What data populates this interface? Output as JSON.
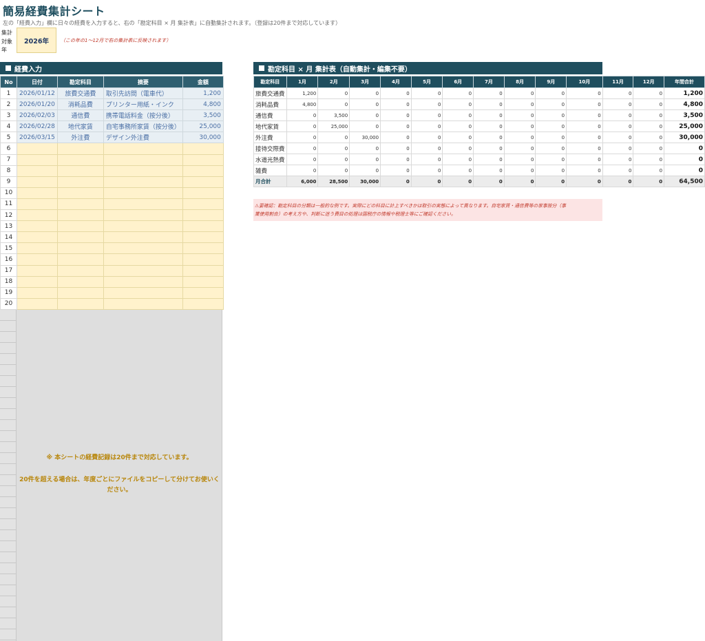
{
  "header": {
    "title": "簡易経費集計シート",
    "subtitle": "左の「経費入力」欄に日々の経費を入力すると、右の「勘定科目 × 月 集計表」に自動集計されます。（登録は20件まで対応しています）"
  },
  "year": {
    "label": "集計対象年",
    "value": "2026年",
    "note": "（この年の1〜12月で右の集計表に反映されます）"
  },
  "left": {
    "section_title": "経費入力",
    "columns": [
      "No",
      "日付",
      "勘定科目",
      "摘要",
      "金額"
    ],
    "rows": [
      {
        "no": "1",
        "date": "2026/01/12",
        "category": "旅費交通費",
        "description": "取引先訪問（電車代）",
        "amount": "1,200"
      },
      {
        "no": "2",
        "date": "2026/01/20",
        "category": "消耗品費",
        "description": "プリンター用紙・インク",
        "amount": "4,800"
      },
      {
        "no": "3",
        "date": "2026/02/03",
        "category": "通信費",
        "description": "携帯電話料金（按分後）",
        "amount": "3,500"
      },
      {
        "no": "4",
        "date": "2026/02/28",
        "category": "地代家賃",
        "description": "自宅事務所家賃（按分後）",
        "amount": "25,000"
      },
      {
        "no": "5",
        "date": "2026/03/15",
        "category": "外注費",
        "description": "デザイン外注費",
        "amount": "30,000"
      },
      {
        "no": "6",
        "date": "",
        "category": "",
        "description": "",
        "amount": ""
      },
      {
        "no": "7",
        "date": "",
        "category": "",
        "description": "",
        "amount": ""
      },
      {
        "no": "8",
        "date": "",
        "category": "",
        "description": "",
        "amount": ""
      },
      {
        "no": "9",
        "date": "",
        "category": "",
        "description": "",
        "amount": ""
      },
      {
        "no": "10",
        "date": "",
        "category": "",
        "description": "",
        "amount": ""
      },
      {
        "no": "11",
        "date": "",
        "category": "",
        "description": "",
        "amount": ""
      },
      {
        "no": "12",
        "date": "",
        "category": "",
        "description": "",
        "amount": ""
      },
      {
        "no": "13",
        "date": "",
        "category": "",
        "description": "",
        "amount": ""
      },
      {
        "no": "14",
        "date": "",
        "category": "",
        "description": "",
        "amount": ""
      },
      {
        "no": "15",
        "date": "",
        "category": "",
        "description": "",
        "amount": ""
      },
      {
        "no": "16",
        "date": "",
        "category": "",
        "description": "",
        "amount": ""
      },
      {
        "no": "17",
        "date": "",
        "category": "",
        "description": "",
        "amount": ""
      },
      {
        "no": "18",
        "date": "",
        "category": "",
        "description": "",
        "amount": ""
      },
      {
        "no": "19",
        "date": "",
        "category": "",
        "description": "",
        "amount": ""
      },
      {
        "no": "20",
        "date": "",
        "category": "",
        "description": "",
        "amount": ""
      }
    ],
    "limit_note_1": "※ 本シートの経費記録は20件まで対応しています。",
    "limit_note_2": "20件を超える場合は、年度ごとにファイルをコピーして分けてお使いください。"
  },
  "right": {
    "section_title": "勘定科目 × 月 集計表（自動集計・編集不要）",
    "columns": [
      "勘定科目",
      "1月",
      "2月",
      "3月",
      "4月",
      "5月",
      "6月",
      "7月",
      "8月",
      "9月",
      "10月",
      "11月",
      "12月",
      "年間合計"
    ],
    "rows": [
      {
        "category": "旅費交通費",
        "months": [
          "1,200",
          "0",
          "0",
          "0",
          "0",
          "0",
          "0",
          "0",
          "0",
          "0",
          "0",
          "0"
        ],
        "total": "1,200"
      },
      {
        "category": "消耗品費",
        "months": [
          "4,800",
          "0",
          "0",
          "0",
          "0",
          "0",
          "0",
          "0",
          "0",
          "0",
          "0",
          "0"
        ],
        "total": "4,800"
      },
      {
        "category": "通信費",
        "months": [
          "0",
          "3,500",
          "0",
          "0",
          "0",
          "0",
          "0",
          "0",
          "0",
          "0",
          "0",
          "0"
        ],
        "total": "3,500"
      },
      {
        "category": "地代家賃",
        "months": [
          "0",
          "25,000",
          "0",
          "0",
          "0",
          "0",
          "0",
          "0",
          "0",
          "0",
          "0",
          "0"
        ],
        "total": "25,000"
      },
      {
        "category": "外注費",
        "months": [
          "0",
          "0",
          "30,000",
          "0",
          "0",
          "0",
          "0",
          "0",
          "0",
          "0",
          "0",
          "0"
        ],
        "total": "30,000"
      },
      {
        "category": "接待交際費",
        "months": [
          "0",
          "0",
          "0",
          "0",
          "0",
          "0",
          "0",
          "0",
          "0",
          "0",
          "0",
          "0"
        ],
        "total": "0"
      },
      {
        "category": "水道光熱費",
        "months": [
          "0",
          "0",
          "0",
          "0",
          "0",
          "0",
          "0",
          "0",
          "0",
          "0",
          "0",
          "0"
        ],
        "total": "0"
      },
      {
        "category": "雑費",
        "months": [
          "0",
          "0",
          "0",
          "0",
          "0",
          "0",
          "0",
          "0",
          "0",
          "0",
          "0",
          "0"
        ],
        "total": "0"
      }
    ],
    "sum_row": {
      "category": "月合計",
      "months": [
        "6,000",
        "28,500",
        "30,000",
        "0",
        "0",
        "0",
        "0",
        "0",
        "0",
        "0",
        "0",
        "0"
      ],
      "total": "64,500"
    },
    "warning_line_1": "⚠要確認：勘定科目の分類は一般的な例です。実際にどの科目に計上すべきかは取引の実態によって異なります。自宅家賃・通信費等の家事按分（事",
    "warning_line_2": "業使用割合）の考え方や、判断に迷う費目の処理は国税庁の情報や税理士等にご確認ください。"
  }
}
